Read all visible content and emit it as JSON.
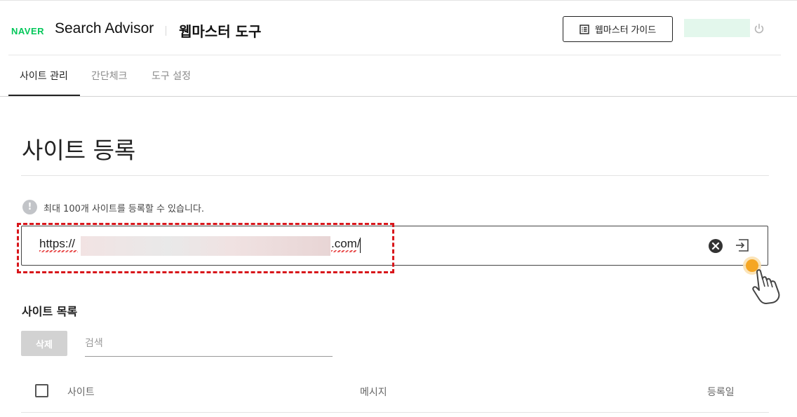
{
  "header": {
    "brand": "NAVER",
    "app_name": "Search Advisor",
    "section": "웹마스터 도구",
    "guide_button": "웹마스터 가이드",
    "icons": {
      "guide": "list-document-icon",
      "power": "power-icon"
    },
    "brand_color": "#03c75a"
  },
  "tabs": [
    {
      "label": "사이트 관리",
      "active": true
    },
    {
      "label": "간단체크",
      "active": false
    },
    {
      "label": "도구 설정",
      "active": false
    }
  ],
  "main": {
    "title": "사이트 등록",
    "notice": "최대 100개 사이트를 등록할 수 있습니다.",
    "notice_icon": "!",
    "url_input": {
      "prefix": "https://",
      "suffix": ".com/"
    },
    "site_list": {
      "title": "사이트 목록",
      "delete_button": "삭제",
      "search_placeholder": "검색",
      "columns": {
        "site": "사이트",
        "message": "메시지",
        "date": "등록일"
      }
    }
  },
  "annotation_color": "#d8161b",
  "pointer_accent": "#f5a623"
}
